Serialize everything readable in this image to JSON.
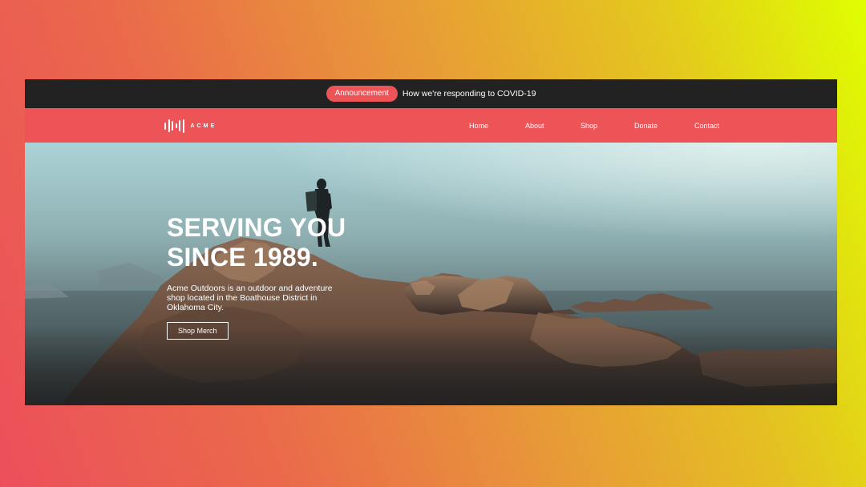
{
  "announcement": {
    "badge_label": "Announcement",
    "message": "How we're responding to COVID-19"
  },
  "brand": {
    "logo_icon": "sound-wave-logo-icon",
    "name": "ACME"
  },
  "nav": {
    "items": [
      {
        "label": "Home"
      },
      {
        "label": "About"
      },
      {
        "label": "Shop"
      },
      {
        "label": "Donate"
      },
      {
        "label": "Contact"
      }
    ]
  },
  "hero": {
    "title_line1": "SERVING YOU",
    "title_line2": "SINCE 1989.",
    "description": "Acme Outdoors is an outdoor and adventure shop located in the Boathouse District in Oklahoma City.",
    "cta_label": "Shop Merch"
  },
  "colors": {
    "brand_red": "#ec5458",
    "announce_bar": "#222222",
    "background_gradient_start": "#ec4f5b",
    "background_gradient_end": "#dfff00"
  }
}
